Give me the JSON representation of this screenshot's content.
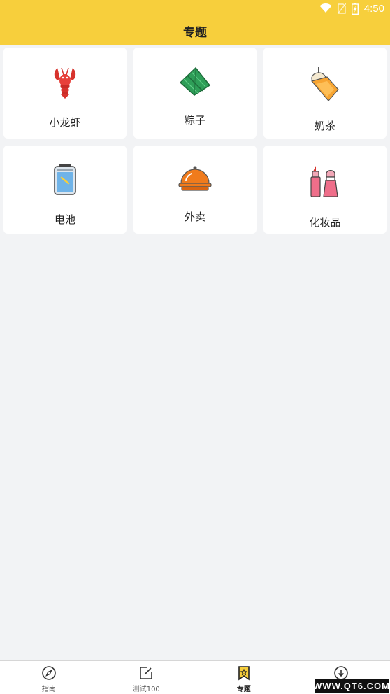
{
  "status_bar": {
    "time": "4:50",
    "icons": [
      "wifi-icon",
      "no-sim-icon",
      "battery-charging-icon"
    ]
  },
  "app_bar": {
    "title": "专题"
  },
  "topics": [
    {
      "label": "小龙虾",
      "icon": "crayfish-icon"
    },
    {
      "label": "粽子",
      "icon": "zongzi-icon"
    },
    {
      "label": "奶茶",
      "icon": "milk-tea-icon"
    },
    {
      "label": "电池",
      "icon": "battery-icon"
    },
    {
      "label": "外卖",
      "icon": "food-delivery-cloche-icon"
    },
    {
      "label": "化妆品",
      "icon": "lipstick-icon"
    }
  ],
  "bottom_nav": {
    "items": [
      {
        "label": "指南",
        "icon": "compass-icon",
        "active": false
      },
      {
        "label": "测试100",
        "icon": "edit-note-icon",
        "active": false
      },
      {
        "label": "专题",
        "icon": "bookmark-star-icon",
        "active": true
      },
      {
        "label": "",
        "icon": "download-icon",
        "active": false
      }
    ]
  },
  "watermark": {
    "text": "WWW.QT6.COM"
  },
  "colors": {
    "header": "#f7cf3c",
    "background": "#f2f3f5",
    "card": "#ffffff",
    "text": "#222222"
  }
}
